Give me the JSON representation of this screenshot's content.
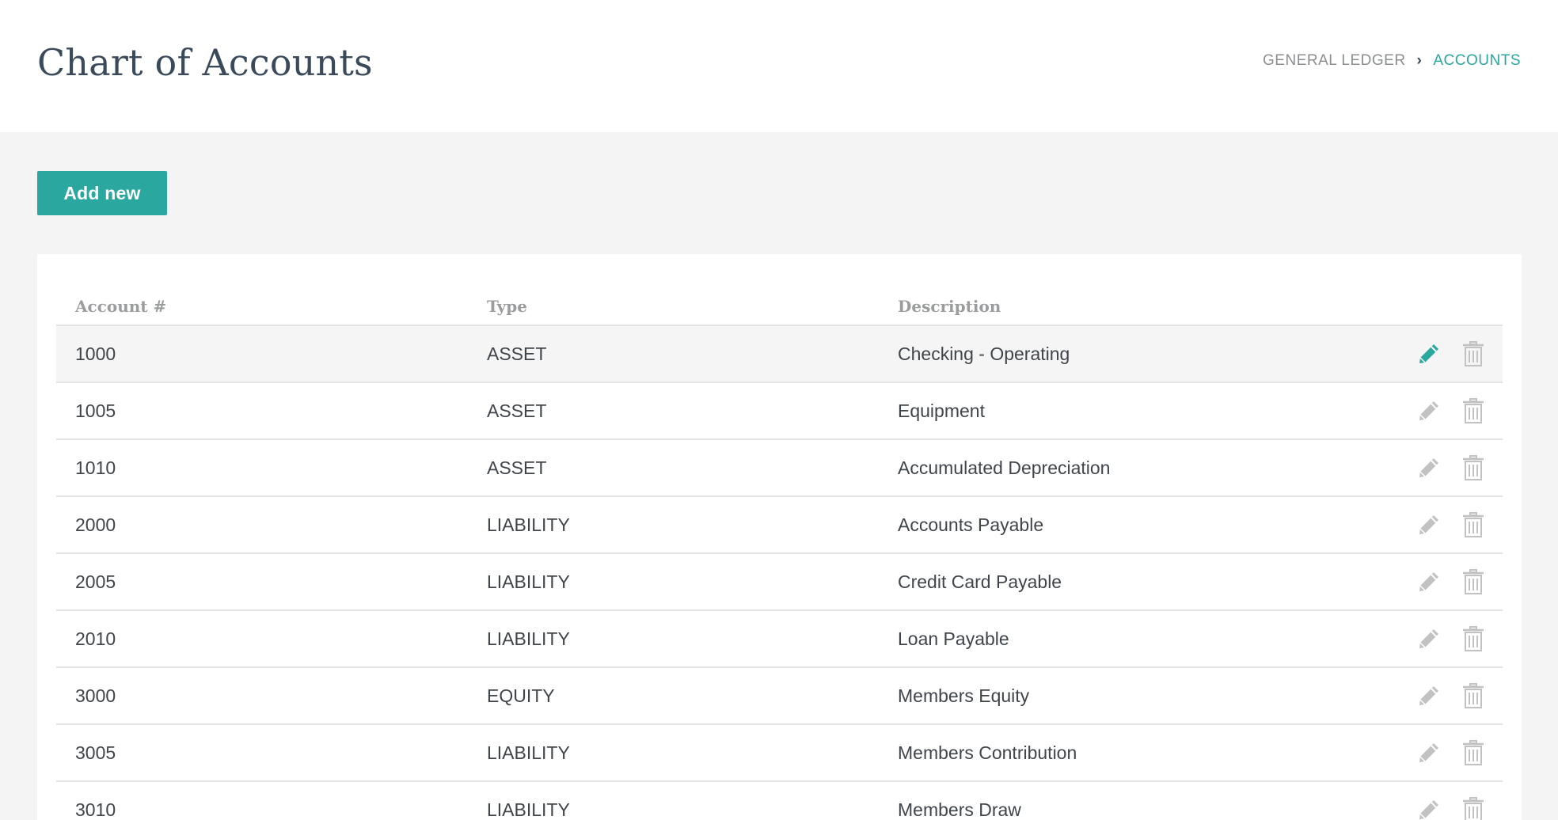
{
  "header": {
    "title": "Chart of Accounts",
    "breadcrumb": [
      "GENERAL LEDGER",
      "ACCOUNTS"
    ],
    "breadcrumb_separator": "›"
  },
  "toolbar": {
    "add_label": "Add new"
  },
  "table": {
    "columns": [
      "Account #",
      "Type",
      "Description"
    ],
    "rows": [
      {
        "account": "1000",
        "type": "ASSET",
        "description": "Checking - Operating"
      },
      {
        "account": "1005",
        "type": "ASSET",
        "description": "Equipment"
      },
      {
        "account": "1010",
        "type": "ASSET",
        "description": "Accumulated Depreciation"
      },
      {
        "account": "2000",
        "type": "LIABILITY",
        "description": "Accounts Payable"
      },
      {
        "account": "2005",
        "type": "LIABILITY",
        "description": "Credit Card Payable"
      },
      {
        "account": "2010",
        "type": "LIABILITY",
        "description": "Loan Payable"
      },
      {
        "account": "3000",
        "type": "EQUITY",
        "description": "Members Equity"
      },
      {
        "account": "3005",
        "type": "LIABILITY",
        "description": "Members Contribution"
      },
      {
        "account": "3010",
        "type": "LIABILITY",
        "description": "Members Draw"
      }
    ],
    "row_actions": [
      "pencil-icon",
      "trash-icon"
    ]
  },
  "colors": {
    "accent": "#2aa79e",
    "icon_muted": "#c2c2c2",
    "title": "#3b4a5a"
  }
}
